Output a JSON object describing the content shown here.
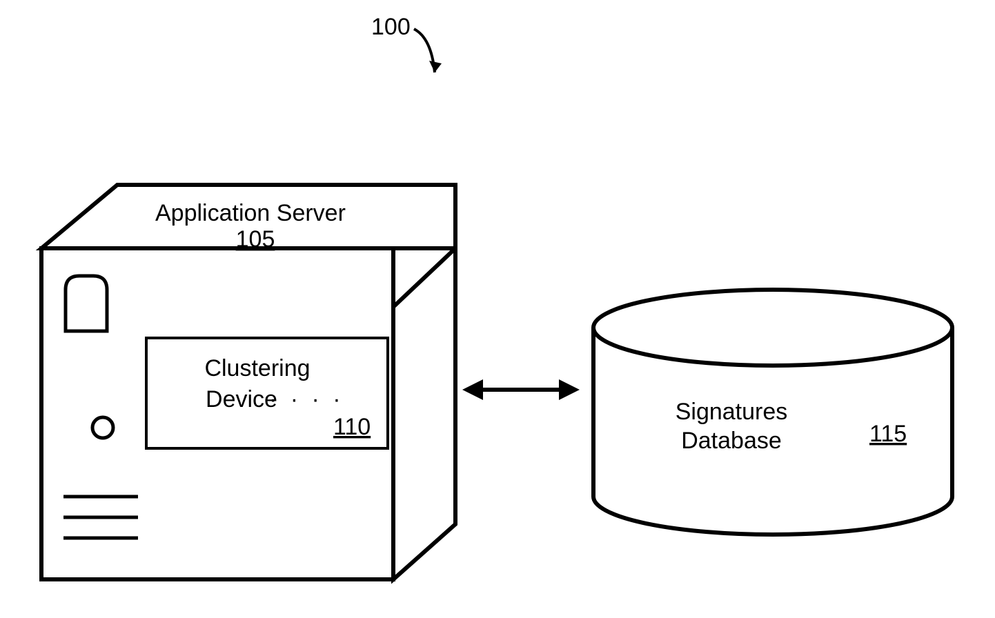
{
  "diagram": {
    "system_ref": "100",
    "server": {
      "label": "Application Server",
      "ref": "105"
    },
    "clustering": {
      "label_line1": "Clustering",
      "label_line2": "Device",
      "ref": "110"
    },
    "database": {
      "label_line1": "Signatures",
      "label_line2": "Database",
      "ref": "115"
    }
  }
}
